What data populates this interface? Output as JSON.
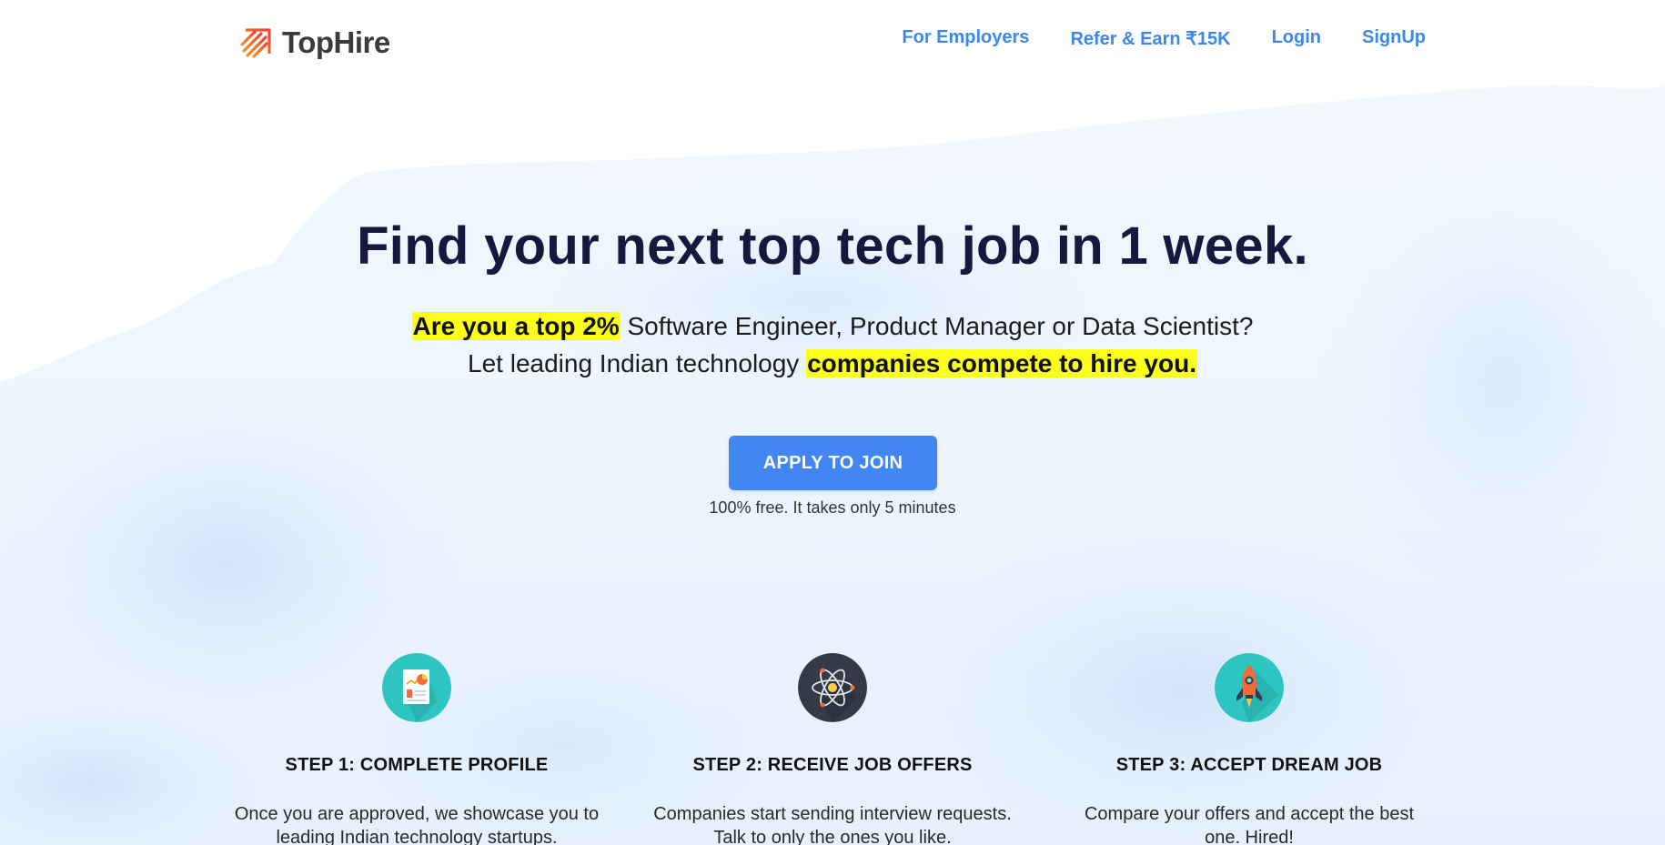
{
  "brand": {
    "name": "TopHire"
  },
  "nav": {
    "items": [
      {
        "label": "For Employers"
      },
      {
        "label": "Refer & Earn ₹15K"
      },
      {
        "label": "Login"
      },
      {
        "label": "SignUp"
      }
    ]
  },
  "hero": {
    "title": "Find your next top tech job in 1 week.",
    "sub_line1_highlight": "Are you a top 2%",
    "sub_line1_rest": " Software Engineer, Product Manager or Data Scientist?",
    "sub_line2_start": "Let leading Indian technology ",
    "sub_line2_highlight": "companies compete to hire you.",
    "cta_label": "APPLY TO JOIN",
    "cta_note": "100% free. It takes only 5 minutes"
  },
  "steps": [
    {
      "icon": "report-chart-icon",
      "title": "STEP 1: COMPLETE PROFILE",
      "desc_line1": "Once you are approved, we showcase you to",
      "desc_line2": "leading Indian technology startups."
    },
    {
      "icon": "atom-icon",
      "title": "STEP 2: RECEIVE JOB OFFERS",
      "desc_line1": "Companies start sending interview requests.",
      "desc_line2": "Talk to only the ones you like."
    },
    {
      "icon": "rocket-icon",
      "title": "STEP 3: ACCEPT DREAM JOB",
      "desc_line1": "Compare your offers and accept the best",
      "desc_line2": "one. Hired!"
    }
  ],
  "colors": {
    "accent": "#4286f1",
    "nav_link": "#3e86f0",
    "highlight": "#fbff1a",
    "title": "#16183d",
    "teal": "#2ec4c0",
    "dark": "#343a46",
    "logo_orange": "#f15a24"
  }
}
